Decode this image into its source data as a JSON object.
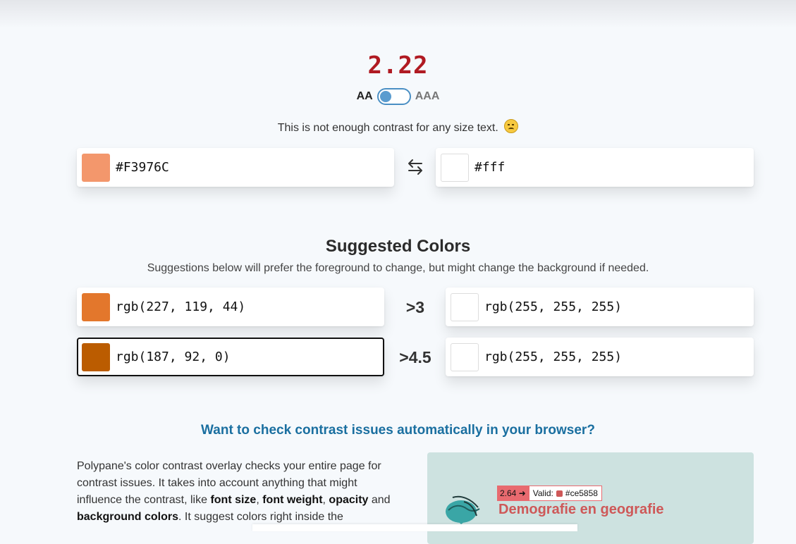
{
  "result": {
    "ratio": "2.22",
    "level_left": "AA",
    "level_right": "AAA",
    "verdict": "This is not enough contrast for any size text."
  },
  "inputs": {
    "foreground": {
      "value": "#F3976C",
      "color": "#F3976C"
    },
    "background": {
      "value": "#fff",
      "color": "#ffffff"
    }
  },
  "suggestions": {
    "title": "Suggested Colors",
    "subtitle": "Suggestions below will prefer the foreground to change, but might change the background if needed.",
    "rows": [
      {
        "threshold": ">3",
        "fg": "rgb(227, 119, 44)",
        "fg_color": "#e3772c",
        "bg": "rgb(255, 255, 255)",
        "bg_color": "#ffffff"
      },
      {
        "threshold": ">4.5",
        "fg": "rgb(187, 92, 0)",
        "fg_color": "#bb5c00",
        "bg": "rgb(255, 255, 255)",
        "bg_color": "#ffffff"
      }
    ]
  },
  "promo": {
    "heading": "Want to check contrast issues automatically in your browser?",
    "text_1": "Polypane's color contrast overlay checks your entire page for contrast issues. It takes into account anything that might influence the contrast, like ",
    "bold_1": "font size",
    "text_2": ", ",
    "bold_2": "font weight",
    "text_3": ", ",
    "bold_3": "opacity",
    "text_4": " and ",
    "bold_4": "background colors",
    "text_5": ". It suggest colors right inside the ",
    "badge_ratio": "2.64 ➜",
    "badge_valid": "Valid:",
    "badge_color": "#ce5858",
    "demo_title": "Demografie en geografie"
  }
}
